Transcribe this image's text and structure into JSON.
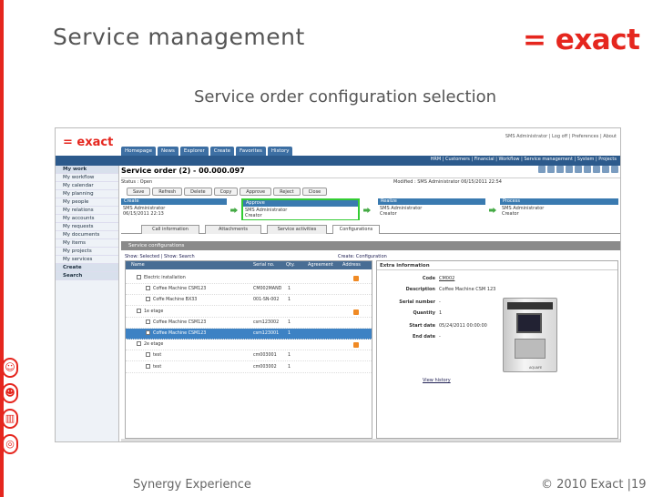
{
  "slide": {
    "title": "Service management",
    "subtitle": "Service order configuration selection",
    "logo": "= exact",
    "footer_left": "Synergy Experience",
    "footer_right": "© 2010 Exact |19"
  },
  "app": {
    "logo": "= exact",
    "user_bar": "SMS Administrator | Log off | Preferences | About",
    "tabs": [
      "Homepage",
      "News",
      "Explorer",
      "Create",
      "Favorites",
      "History"
    ],
    "menu": "HRM | Customers | Financial | Workflow | Service management | System | Projects",
    "sidebar": [
      {
        "label": "My work",
        "head": true
      },
      {
        "label": "My workflow",
        "head": false
      },
      {
        "label": "My calendar",
        "head": false
      },
      {
        "label": "My planning",
        "head": false
      },
      {
        "label": "My people",
        "head": false
      },
      {
        "label": "My relations",
        "head": false
      },
      {
        "label": "My accounts",
        "head": false
      },
      {
        "label": "My requests",
        "head": false
      },
      {
        "label": "My documents",
        "head": false
      },
      {
        "label": "My items",
        "head": false
      },
      {
        "label": "My projects",
        "head": false
      },
      {
        "label": "My services",
        "head": false
      },
      {
        "label": "Create",
        "head": true
      },
      {
        "label": "Search",
        "head": true
      }
    ],
    "order_title": "Service order (2) - 00.000.097",
    "status": "Status : Open",
    "modified": "Modified : SMS Administrator 06/15/2011 22:54",
    "buttons": [
      "Save",
      "Refresh",
      "Delete",
      "Copy",
      "Approve",
      "Reject",
      "Close"
    ],
    "flow": [
      {
        "head": "Create",
        "line1": "SMS Administrator",
        "line2": "06/15/2011 22:13"
      },
      {
        "head": "Approve",
        "line1": "SMS Administrator",
        "line2": "Creator"
      },
      {
        "head": "Realize",
        "line1": "SMS Administrator",
        "line2": "Creator"
      },
      {
        "head": "Process",
        "line1": "SMS Administrator",
        "line2": "Creator"
      }
    ],
    "subtabs": [
      "Call information",
      "Attachments",
      "Service activities",
      "Configurations"
    ],
    "section_title": "Service configurations",
    "show_links": "Show: Selected | Show: Search",
    "create_link": "Create: Configuration",
    "grid": {
      "headers": [
        "Name",
        "Serial no.",
        "Qty.",
        "Agreement",
        "Address"
      ],
      "rows": [
        {
          "name": "Electric installation",
          "serial": "",
          "qty": "",
          "indent": 1,
          "warn": true,
          "sel": false
        },
        {
          "name": "Coffee Machine CSM123",
          "serial": "CM002MAND",
          "qty": "1",
          "indent": 2,
          "warn": false,
          "sel": false
        },
        {
          "name": "Coffe Machine BX33",
          "serial": "001-SN-002",
          "qty": "1",
          "indent": 2,
          "warn": false,
          "sel": false
        },
        {
          "name": "1e etage",
          "serial": "",
          "qty": "",
          "indent": 1,
          "warn": true,
          "sel": false
        },
        {
          "name": "Coffee Machine CSM123",
          "serial": "csm123002",
          "qty": "1",
          "indent": 2,
          "warn": false,
          "sel": false
        },
        {
          "name": "Coffee Machine CSM123",
          "serial": "csm123001",
          "qty": "1",
          "indent": 2,
          "warn": false,
          "sel": true
        },
        {
          "name": "2e etage",
          "serial": "",
          "qty": "",
          "indent": 1,
          "warn": true,
          "sel": false
        },
        {
          "name": "test",
          "serial": "cm003001",
          "qty": "1",
          "indent": 2,
          "warn": false,
          "sel": false
        },
        {
          "name": "test",
          "serial": "cm003002",
          "qty": "1",
          "indent": 2,
          "warn": false,
          "sel": false
        }
      ]
    },
    "extra": {
      "title": "Extra information",
      "fields": [
        {
          "k": "Code",
          "v": "CM002"
        },
        {
          "k": "Description",
          "v": "Coffee Machine CSM 123"
        },
        {
          "k": "Serial number",
          "v": "-"
        },
        {
          "k": "Quantity",
          "v": "1"
        },
        {
          "k": "Start date",
          "v": "05/24/2011 00:00:00"
        },
        {
          "k": "End date",
          "v": "-"
        }
      ],
      "history_link": "View history",
      "machine_brand": "AQUAFE"
    }
  }
}
